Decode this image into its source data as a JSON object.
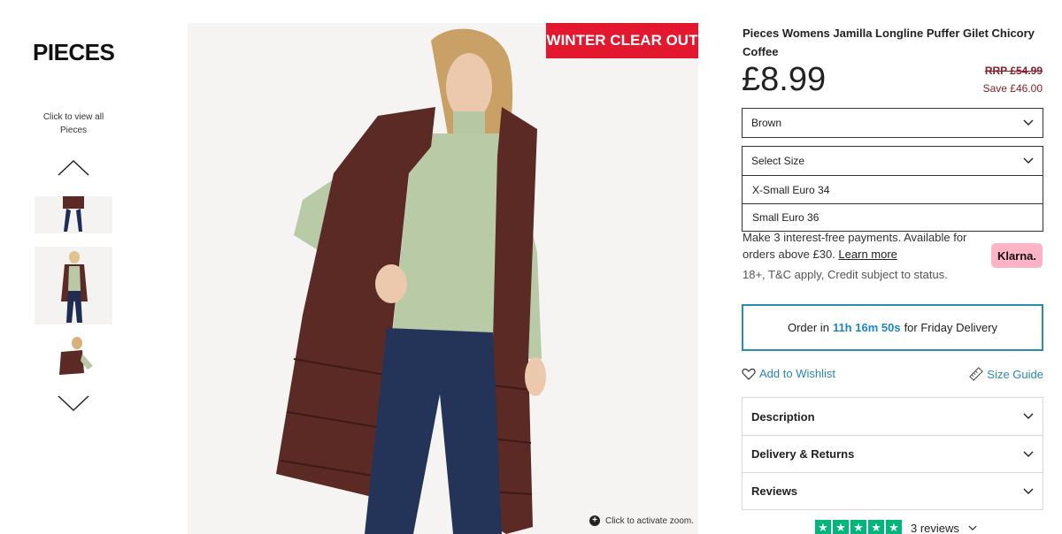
{
  "brand": {
    "logo_text": "PIECES",
    "view_all_text": "Click to view all Pieces"
  },
  "gallery": {
    "badge": "WINTER CLEAR OUT",
    "zoom_hint": "Click to activate zoom."
  },
  "product": {
    "title": "Pieces Womens Jamilla Longline Puffer Gilet Chicory Coffee",
    "price": "£8.99",
    "rrp": "RRP £54.99",
    "save": "Save £46.00"
  },
  "colour_select": {
    "value": "Brown"
  },
  "size_select": {
    "placeholder": "Select Size",
    "options": [
      "X-Small Euro 34",
      "Small Euro 36"
    ]
  },
  "klarna": {
    "text": "Make 3 interest-free payments. Available for orders above £30.",
    "learn_more": "Learn more",
    "terms": "18+, T&C apply, Credit subject to status.",
    "badge": "Klarna."
  },
  "delivery": {
    "prefix": "Order in",
    "countdown": "11h 16m 50s",
    "suffix": "for Friday Delivery"
  },
  "actions": {
    "wishlist": "Add to Wishlist",
    "size_guide": "Size Guide"
  },
  "accordion": [
    "Description",
    "Delivery & Returns",
    "Reviews"
  ],
  "reviews": {
    "count_text": "3 reviews",
    "rating_stars": 5
  },
  "colors": {
    "badge_red": "#e3172d",
    "price_red": "#8a1d2a",
    "link_blue": "#2a86b8",
    "klarna_pink": "#ffb3c7",
    "trustpilot_green": "#00b67a"
  }
}
